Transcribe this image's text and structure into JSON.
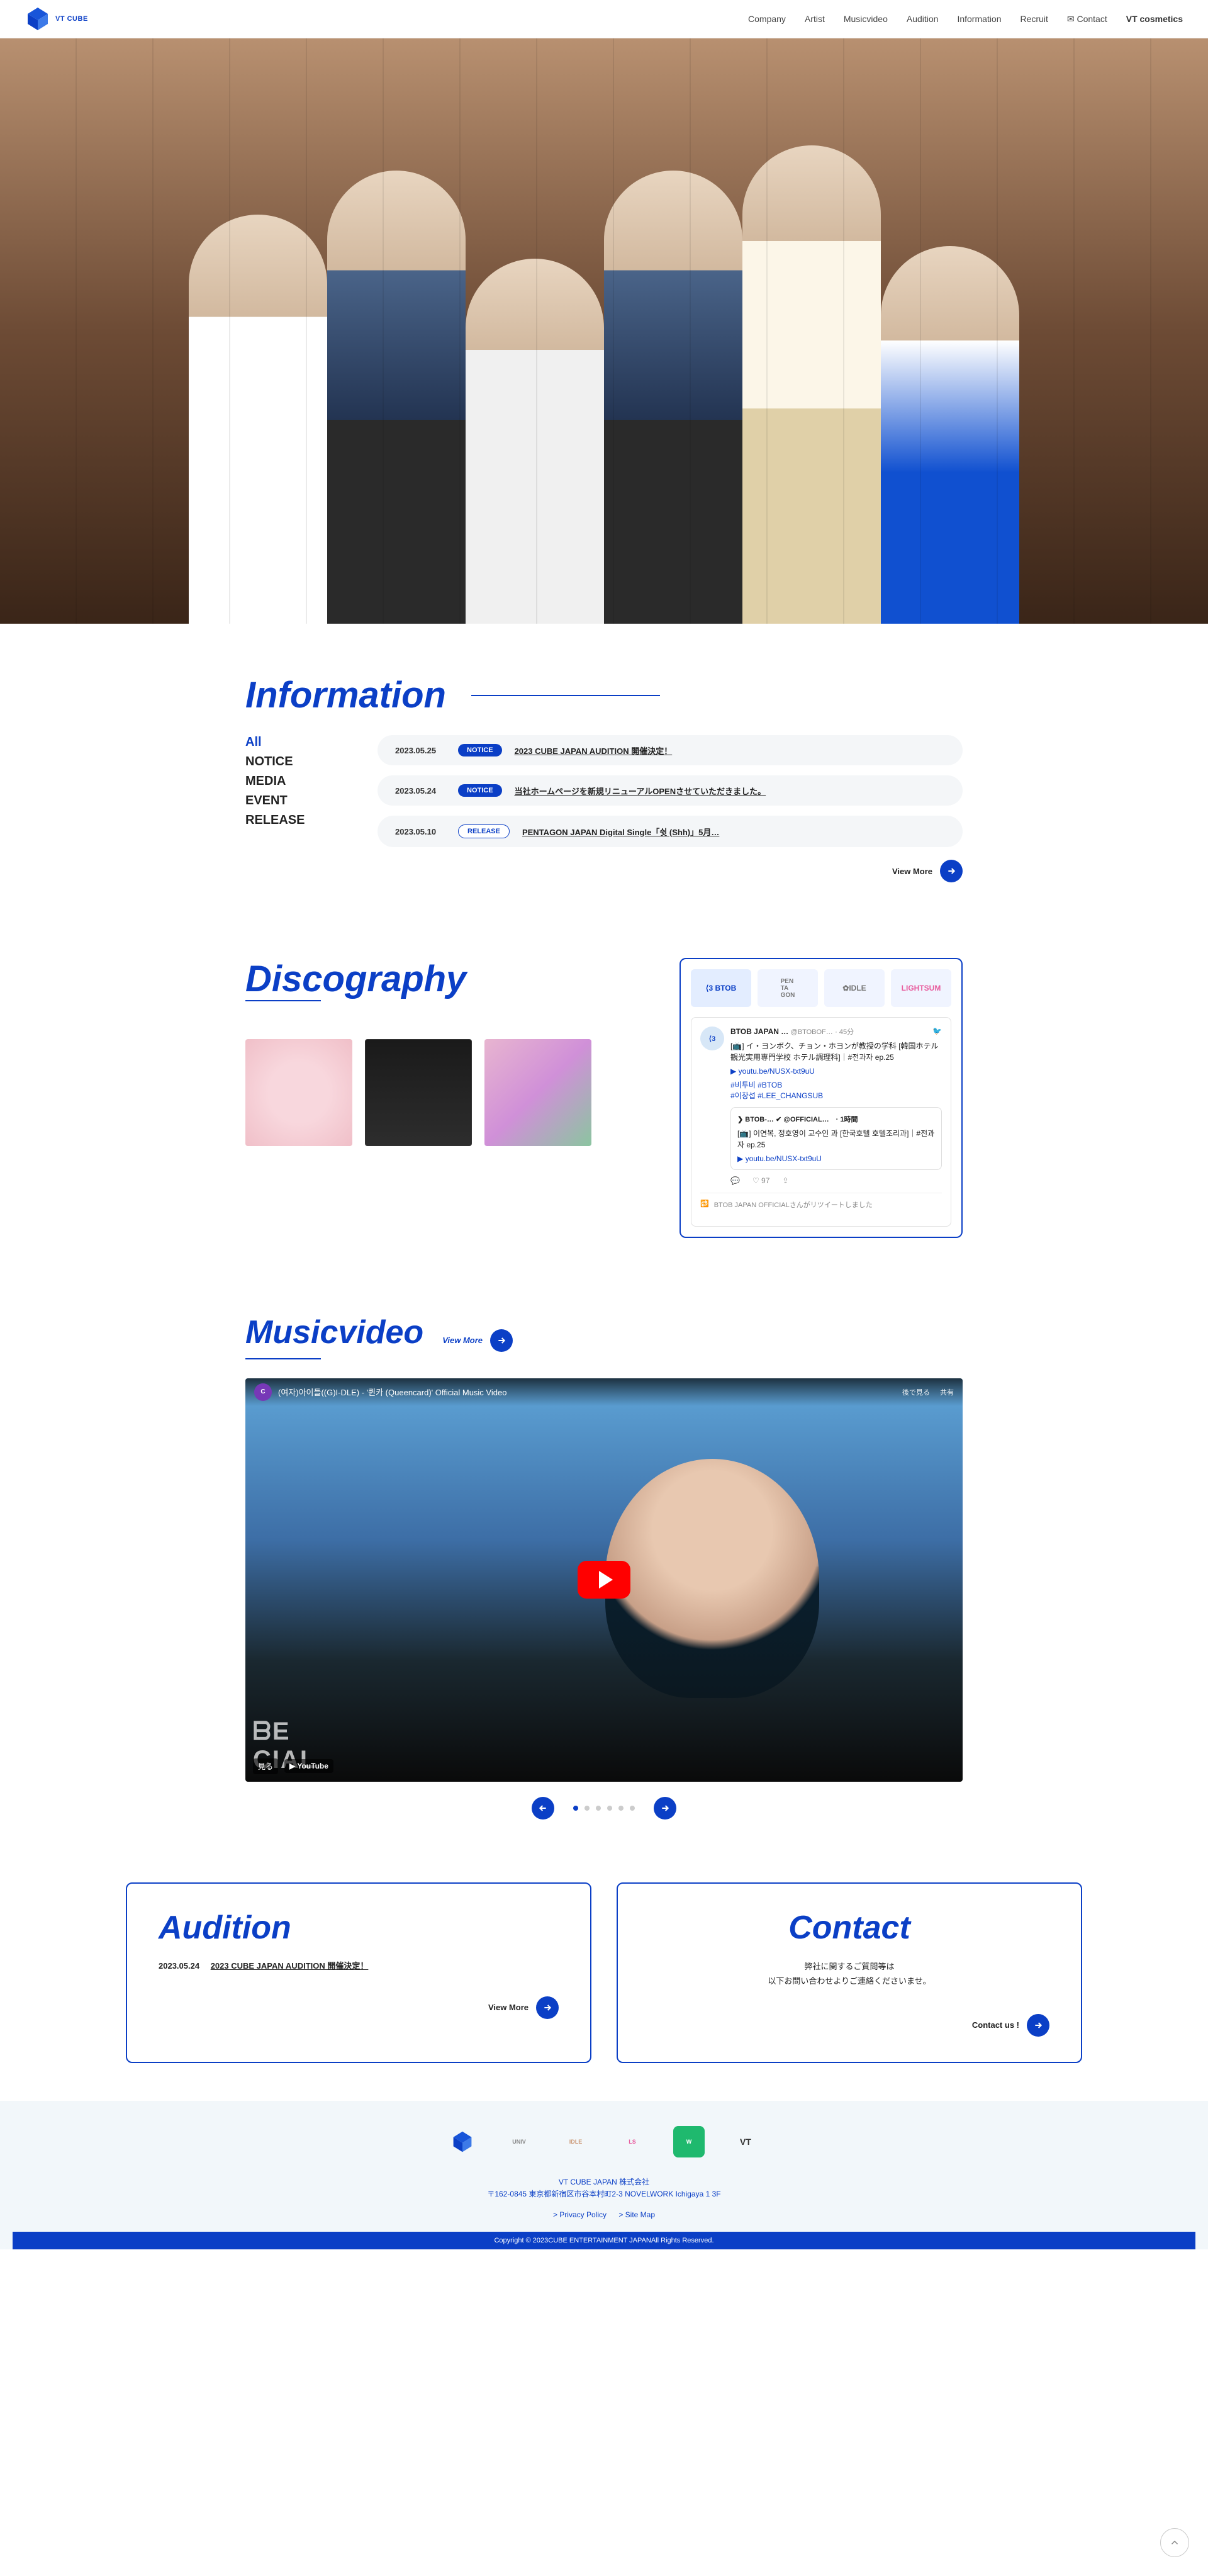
{
  "brand": {
    "logo_text": "VT CUBE"
  },
  "nav": {
    "company": "Company",
    "artist": "Artist",
    "musicvideo": "Musicvideo",
    "audition": "Audition",
    "information": "Information",
    "recruit": "Recruit",
    "contact": "Contact",
    "vt": "VT cosmetics"
  },
  "info": {
    "title": "Information",
    "tabs": {
      "all": "All",
      "notice": "NOTICE",
      "media": "MEDIA",
      "event": "EVENT",
      "release": "RELEASE"
    },
    "rows": [
      {
        "date": "2023.05.25",
        "badge": "NOTICE",
        "badge_class": "badge-notice",
        "text": "2023 CUBE JAPAN AUDITION 開催決定！"
      },
      {
        "date": "2023.05.24",
        "badge": "NOTICE",
        "badge_class": "badge-notice",
        "text": "当社ホームページを新規リニューアルOPENさせていただきました。"
      },
      {
        "date": "2023.05.10",
        "badge": "RELEASE",
        "badge_class": "badge-release",
        "text": "PENTAGON JAPAN Digital Single「쉿 (Shh)」5月…"
      }
    ],
    "view_more": "View More"
  },
  "disco": {
    "title": "Discography",
    "tw": {
      "tabs": {
        "btob": "⟨3 BTOB",
        "pentagon": "PEN\nTA\nGON",
        "gidle": "✿IDLE",
        "lightsum": "LIGHTSUM"
      },
      "handle": "BTOB JAPAN …",
      "at": "@BTOBOF…",
      "time": "· 45分",
      "body": "[📺] イ・ヨンボク、チョン・ホヨンが教授の学科 [韓国ホテル観光実用専門学校 ホテル調理科]｜#전과자 ep.25",
      "link": "▶ youtu.be/NUSX-txt9uU",
      "tags": "#비투비 #BTOB\n#이창섭 #LEE_CHANGSUB",
      "quote_handle": "❯ BTOB-… ✔ @OFFICIAL…　· 1時間",
      "quote_body": "[📺] 이연복, 정호영이 교수인 과 [한국호텔 호텔조리과]｜#전과자 ep.25",
      "quote_link": "▶ youtu.be/NUSX-txt9uU",
      "likes": "97",
      "retweet": "BTOB JAPAN OFFICIALさんがリツイートしました"
    }
  },
  "mv": {
    "title": "Musicvideo",
    "view_more": "View More",
    "video_title": "(여자)아이들((G)I-DLE) - '퀸카 (Queencard)' Official Music Video",
    "share1": "後で見る",
    "share2": "共有",
    "watch_on": "見る",
    "youtube": "▶ YouTube",
    "corner": "ᗷE\nCIAL"
  },
  "audition": {
    "title": "Audition",
    "date": "2023.05.24",
    "text": "2023 CUBE JAPAN AUDITION 開催決定！",
    "view_more": "View More"
  },
  "contact": {
    "title": "Contact",
    "desc1": "弊社に関するご質問等は",
    "desc2": "以下お問い合わせよりご連絡くださいませ。",
    "cta": "Contact us !"
  },
  "footer": {
    "logos": {
      "cube": "CUBE",
      "univ": "UNIV",
      "idle": "IDLE",
      "lightsum": "LS",
      "w": "W",
      "vt": "VT"
    },
    "company1": "VT CUBE JAPAN 株式会社",
    "company2": "〒162-0845 東京都新宿区市谷本村町2-3 NOVELWORK Ichigaya 1 3F",
    "privacy": "> Privacy Policy",
    "sitemap": "> Site Map",
    "copyright": "Copyright © 2023CUBE ENTERTAINMENT JAPANAll Rights Reserved."
  }
}
